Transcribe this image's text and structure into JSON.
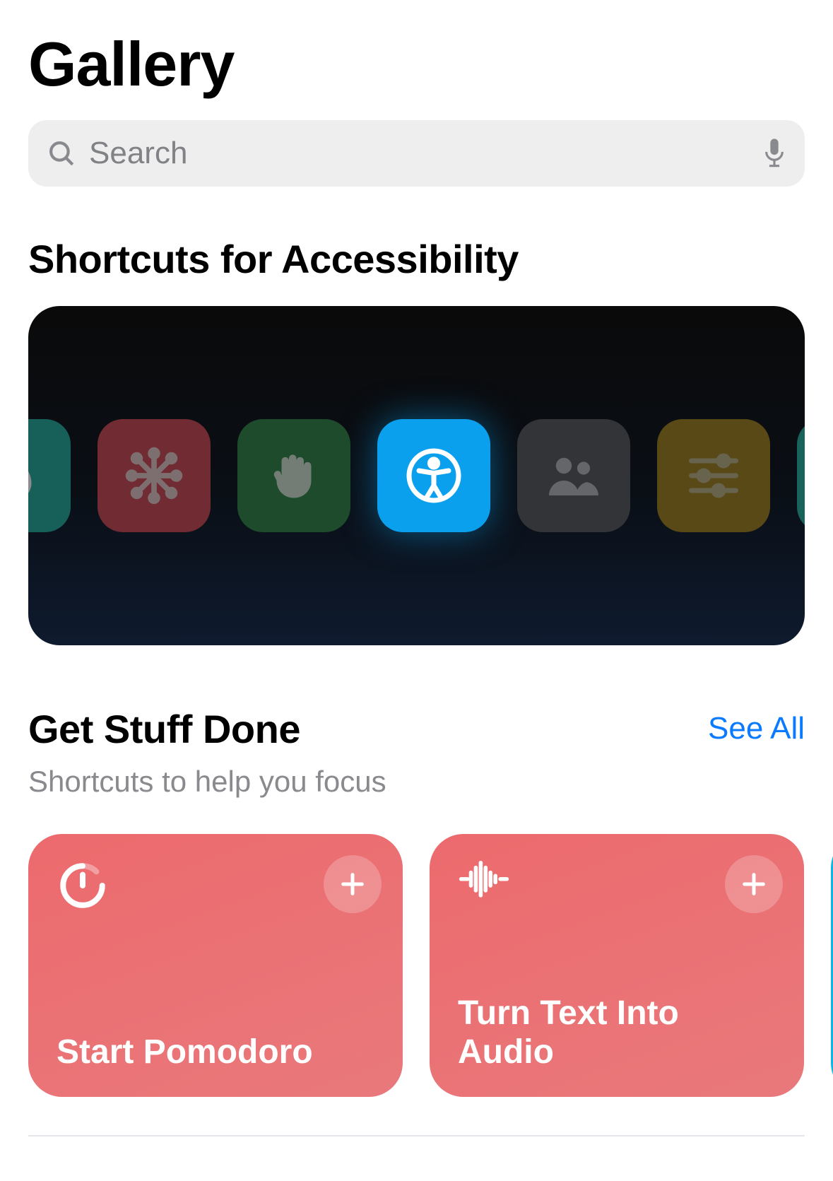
{
  "page_title": "Gallery",
  "search": {
    "placeholder": "Search"
  },
  "banner": {
    "title": "Shortcuts for Accessibility",
    "tiles": [
      {
        "name": "water-icon",
        "color": "teal"
      },
      {
        "name": "asterisk-icon",
        "color": "red"
      },
      {
        "name": "hand-icon",
        "color": "green"
      },
      {
        "name": "accessibility-icon",
        "color": "blue"
      },
      {
        "name": "people-icon",
        "color": "gray"
      },
      {
        "name": "sliders-icon",
        "color": "yellow"
      },
      {
        "name": "sparkle-icon",
        "color": "teal2"
      }
    ]
  },
  "section2": {
    "title": "Get Stuff Done",
    "subtitle": "Shortcuts to help you focus",
    "see_all": "See All",
    "cards": [
      {
        "title": "Start Pomodoro",
        "icon": "timer-icon",
        "color": "salmon"
      },
      {
        "title": "Turn Text Into Audio",
        "icon": "waveform-icon",
        "color": "salmon"
      }
    ]
  }
}
